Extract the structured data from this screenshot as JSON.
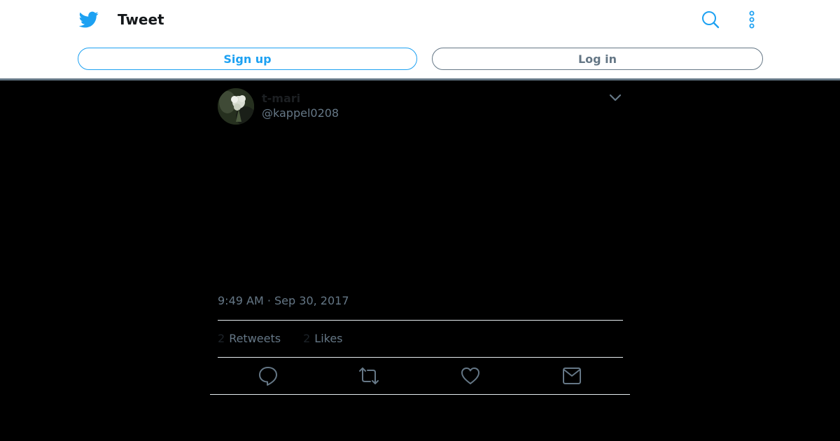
{
  "header": {
    "title": "Tweet",
    "brand_color": "#1da1f2",
    "icons": [
      "twitter-bird-icon",
      "search-icon",
      "more-vertical-icon"
    ]
  },
  "auth": {
    "signup_label": "Sign up",
    "login_label": "Log in"
  },
  "tweet": {
    "display_name": "t-mari",
    "handle": "@kappel0208",
    "timestamp": "9:49 AM · Sep 30, 2017",
    "retweets": {
      "count": "2",
      "label": "Retweets"
    },
    "likes": {
      "count": "2",
      "label": "Likes"
    }
  },
  "actions": [
    "reply-icon",
    "retweet-icon",
    "like-icon",
    "direct-message-icon"
  ],
  "colors": {
    "background": "#000000",
    "muted": "#657786",
    "divider": "#e6ecf0"
  }
}
